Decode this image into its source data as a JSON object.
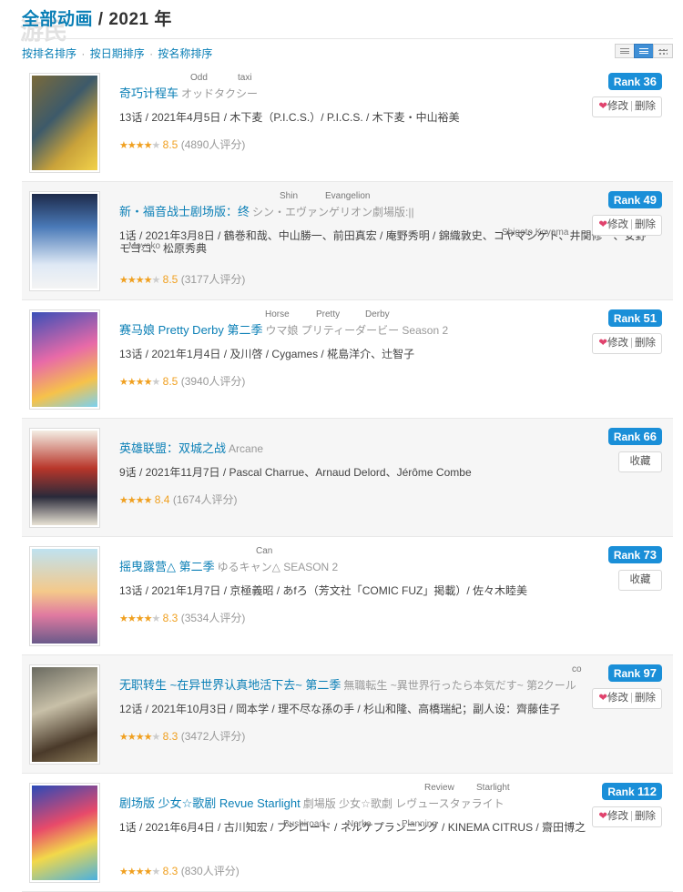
{
  "header": {
    "title_link": "全部动画",
    "title_rest": " / 2021 年",
    "watermark": "游民"
  },
  "sortbar": {
    "sorts": [
      "按排名排序",
      "按日期排序",
      "按名称排序"
    ],
    "separator": "·"
  },
  "items": [
    {
      "title_cn": "奇巧计程车",
      "title_jp": "オッドタクシー",
      "ruby": [
        "Odd",
        "taxi"
      ],
      "meta": "13话 / 2021年4月5日 / 木下麦（P.I.C.S.）/ P.I.C.S. / 木下麦・中山裕美",
      "stars": "★★★★",
      "stars_off": "★",
      "score": "8.5",
      "votes": "(4890人评分)",
      "rank_label": "Rank",
      "rank": "36",
      "action": "edit",
      "action_edit": "修改",
      "action_delete": "删除"
    },
    {
      "title_cn": "新・福音战士剧场版：终",
      "title_jp": "シン・エヴァンゲリオン劇場版:||",
      "ruby": [
        "Shin",
        "Evangelion"
      ],
      "ruby2": [
        "Shigeto Koyama",
        "Moyoko"
      ],
      "meta": "1话 / 2021年3月8日 / 鶴巻和哉、中山勝一、前田真宏 / 庵野秀明 / 錦織敦史、コヤマシゲト、井関修一、安野モヨコ、松原秀典",
      "stars": "★★★★",
      "stars_off": "★",
      "score": "8.5",
      "votes": "(3177人评分)",
      "rank_label": "Rank",
      "rank": "49",
      "action": "edit",
      "action_edit": "修改",
      "action_delete": "删除"
    },
    {
      "title_cn": "赛马娘 Pretty Derby 第二季",
      "title_jp": "ウマ娘 プリティーダービー Season 2",
      "ruby": [
        "Horse",
        "Pretty",
        "Derby"
      ],
      "meta": "13话 / 2021年1月4日 / 及川啓 / Cygames / 椛島洋介、辻智子",
      "stars": "★★★★",
      "stars_off": "★",
      "score": "8.5",
      "votes": "(3940人评分)",
      "rank_label": "Rank",
      "rank": "51",
      "action": "edit",
      "action_edit": "修改",
      "action_delete": "删除"
    },
    {
      "title_cn": "英雄联盟：双城之战",
      "title_jp": "Arcane",
      "ruby": [],
      "meta": "9话 / 2021年11月7日 / Pascal Charrue、Arnaud Delord、Jérôme Combe",
      "stars": "★★★★",
      "stars_off": "",
      "score": "8.4",
      "votes": "(1674人评分)",
      "rank_label": "Rank",
      "rank": "66",
      "action": "collect",
      "action_collect": "收藏"
    },
    {
      "title_cn": "摇曳露营△ 第二季",
      "title_jp": "ゆるキャン△ SEASON 2",
      "ruby": [
        "Can"
      ],
      "meta": "13话 / 2021年1月7日 / 京極義昭 / あfろ（芳文社「COMIC FUZ」掲載）/ 佐々木睦美",
      "stars": "★★★★",
      "stars_off": "★",
      "score": "8.3",
      "votes": "(3534人评分)",
      "rank_label": "Rank",
      "rank": "73",
      "action": "collect",
      "action_collect": "收藏"
    },
    {
      "title_cn": "无职转生 ~在异世界认真地活下去~ 第二季",
      "title_jp": "無職転生 ~異世界行ったら本気だす~ 第2クール",
      "ruby": [
        "co"
      ],
      "meta": "12话 / 2021年10月3日 / 岡本学 / 理不尽な孫の手 / 杉山和隆、高橋瑞紀；副人设：齊藤佳子",
      "stars": "★★★★",
      "stars_off": "★",
      "score": "8.3",
      "votes": "(3472人评分)",
      "rank_label": "Rank",
      "rank": "97",
      "action": "edit",
      "action_edit": "修改",
      "action_delete": "删除"
    },
    {
      "title_cn": "剧场版 少女☆歌剧 Revue Starlight",
      "title_jp": "劇場版 少女☆歌劇 レヴュースタァライト",
      "ruby": [
        "Review",
        "Starlight"
      ],
      "ruby2": [
        "Bushiroad",
        "Nerke",
        "Planning"
      ],
      "meta": "1话 / 2021年6月4日 / 古川知宏 / ブシロード / ネルケプランニング / KINEMA CITRUS / 齋田博之",
      "stars": "★★★★",
      "stars_off": "★",
      "score": "8.3",
      "votes": "(830人评分)",
      "rank_label": "Rank",
      "rank": "112",
      "action": "edit",
      "action_edit": "修改",
      "action_delete": "删除"
    }
  ],
  "colors": {
    "link": "#0a7fb6",
    "rank_badge": "#1a8fd8",
    "star": "#f0a020",
    "heart": "#e0436d"
  }
}
